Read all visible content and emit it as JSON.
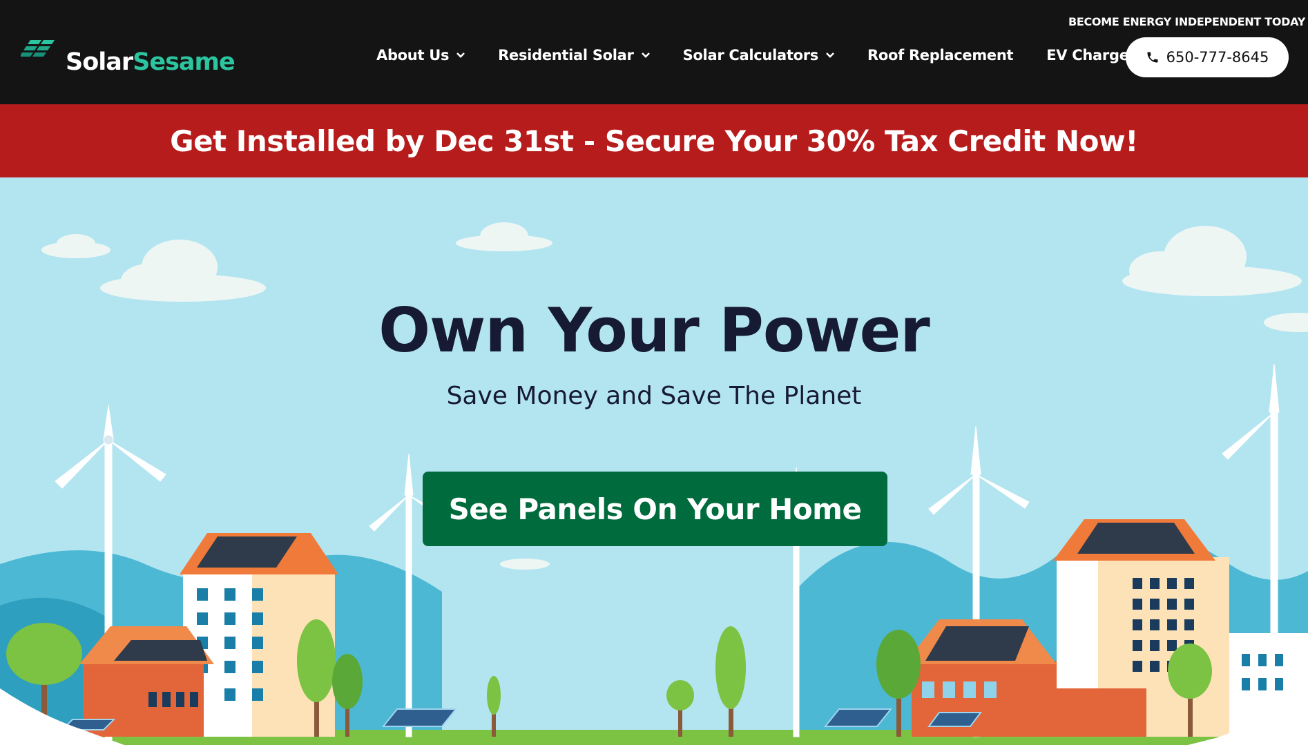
{
  "brand": {
    "name_part1": "Solar",
    "name_part2": "Sesame",
    "logo_icon": "solar-panels-icon",
    "colors": {
      "white": "#ffffff",
      "teal": "#2cc5a0"
    }
  },
  "header": {
    "tagline": "BECOME ENERGY INDEPENDENT TODAY",
    "background": "#141414",
    "nav": [
      {
        "label": "About Us",
        "has_dropdown": true
      },
      {
        "label": "Residential Solar",
        "has_dropdown": true
      },
      {
        "label": "Solar Calculators",
        "has_dropdown": true
      },
      {
        "label": "Roof Replacement",
        "has_dropdown": false
      },
      {
        "label": "EV Charger",
        "has_dropdown": false
      }
    ],
    "phone": {
      "label": "650-777-8645",
      "icon": "phone-icon"
    }
  },
  "promo": {
    "text": "Get Installed by Dec 31st - Secure Your 30% Tax Credit Now!",
    "background": "#b71c1c"
  },
  "hero": {
    "title": "Own Your Power",
    "subtitle": "Save Money and Save The Planet",
    "cta_label": "See Panels On Your Home",
    "cta_color": "#006b3c",
    "sky_color": "#b3e5f0"
  }
}
